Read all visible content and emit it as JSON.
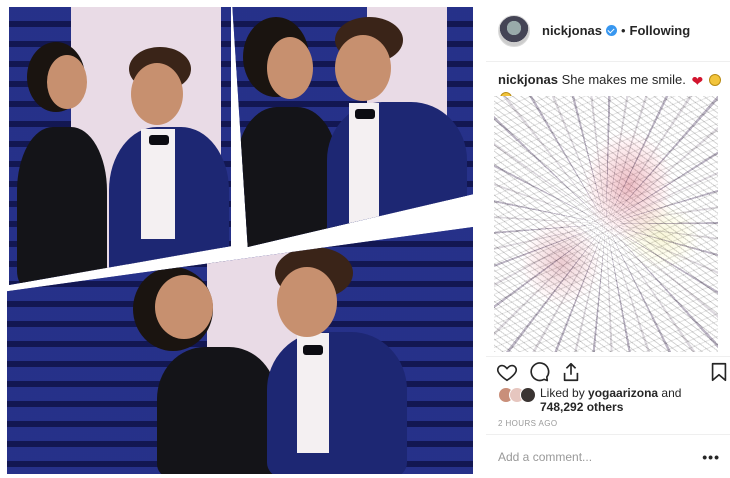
{
  "post": {
    "header": {
      "username": "nickjonas",
      "separator": "•",
      "follow_status": "Following",
      "avatar_icon": "profile-avatar",
      "verified_icon": "verified-badge-icon",
      "verified_color": "#3897f0"
    },
    "caption": {
      "username": "nickjonas",
      "text": "She makes me smile.",
      "emojis": [
        "heart-emoji",
        "grinning-face-emoji",
        "kissing-face-emoji"
      ],
      "heart_color": "#d2152e"
    },
    "media": {
      "description_icon": "photo-collage"
    },
    "actions": {
      "like_icon": "heart-outline-icon",
      "comment_icon": "speech-bubble-icon",
      "share_icon": "share-upload-icon",
      "save_icon": "bookmark-icon"
    },
    "likes": {
      "prefix": "Liked by",
      "first_liker": "yogaarizona",
      "connector": "and",
      "count_text": "748,292 others"
    },
    "timestamp": "2 HOURS AGO",
    "comment_box": {
      "placeholder": "Add a comment...",
      "more_icon_glyph": "•••"
    }
  }
}
